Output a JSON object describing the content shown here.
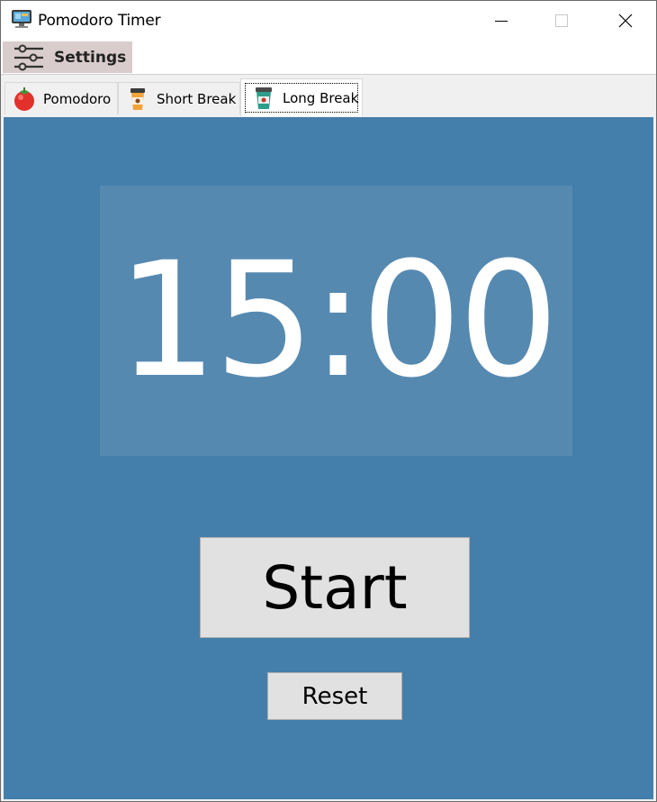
{
  "window": {
    "title": "Pomodoro Timer",
    "app_icon": "monitor-app-icon",
    "controls": {
      "minimize_icon": "minimize-icon",
      "maximize_icon": "maximize-icon",
      "close_icon": "close-icon"
    }
  },
  "menubar": {
    "settings_label": "Settings",
    "settings_icon": "sliders-icon"
  },
  "tabs": [
    {
      "label": "Pomodoro",
      "icon": "tomato-icon",
      "selected": false
    },
    {
      "label": "Short Break",
      "icon": "coffee-cup-icon",
      "selected": false
    },
    {
      "label": "Long Break",
      "icon": "teal-cup-icon",
      "selected": true
    }
  ],
  "timer": {
    "display": "15:00"
  },
  "buttons": {
    "start_label": "Start",
    "reset_label": "Reset"
  },
  "colors": {
    "panel_background": "#447fab",
    "timer_box": "#5689b0",
    "settings_highlight": "#d8cccc",
    "button_face": "#e1e1e1"
  }
}
